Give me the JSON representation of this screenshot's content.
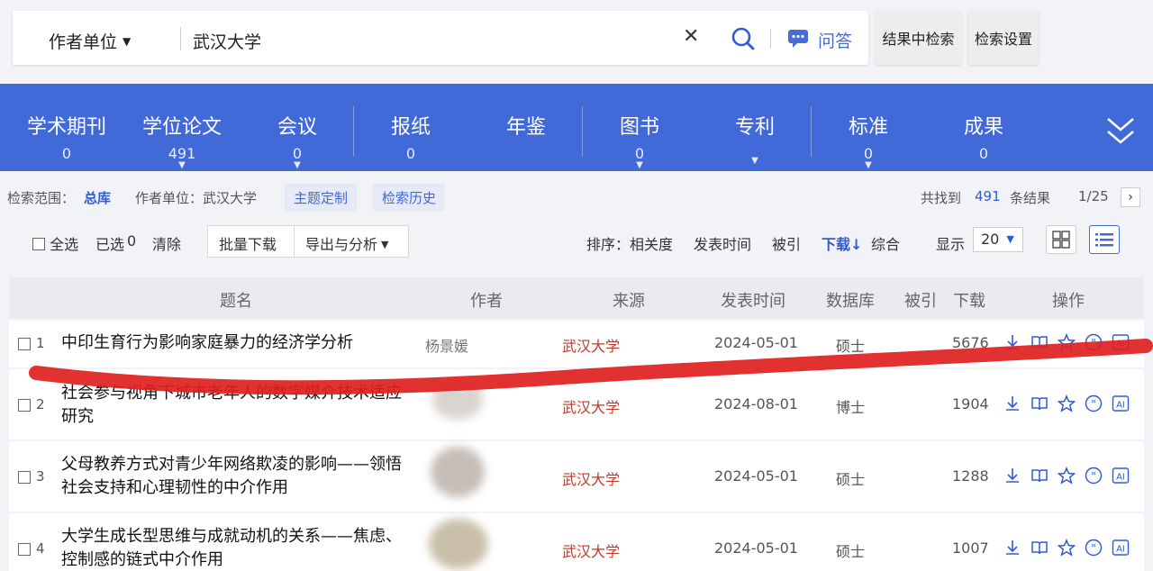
{
  "search": {
    "field": "作者单位",
    "query": "武汉大学",
    "qa_label": "问答",
    "within_results": "结果中检索",
    "settings": "检索设置"
  },
  "tabs": [
    {
      "label": "学术期刊",
      "count": "0"
    },
    {
      "label": "学位论文",
      "count": "491"
    },
    {
      "label": "会议",
      "count": "0"
    },
    {
      "label": "报纸",
      "count": "0"
    },
    {
      "label": "年鉴",
      "count": ""
    },
    {
      "label": "图书",
      "count": "0"
    },
    {
      "label": "专利",
      "count": ""
    },
    {
      "label": "标准",
      "count": "0"
    },
    {
      "label": "成果",
      "count": "0"
    }
  ],
  "scope": {
    "label": "检索范围：",
    "value": "总库",
    "filter": "作者单位：武汉大学",
    "topic_btn": "主题定制",
    "history_btn": "检索历史",
    "found_label": "共找到",
    "found_count": "491",
    "found_suffix": "条结果",
    "page": "1/25"
  },
  "toolbar": {
    "select_all": "全选",
    "selected": "已选",
    "selected_count": "0",
    "clear": "清除",
    "batch_download": "批量下载",
    "export": "导出与分析",
    "sort_label": "排序：",
    "sort_relevance": "相关度",
    "sort_date": "发表时间",
    "sort_cited": "被引",
    "sort_download": "下载",
    "sort_combined": "综合",
    "display_label": "显示",
    "page_size": "20"
  },
  "table": {
    "headers": {
      "title": "题名",
      "author": "作者",
      "source": "来源",
      "date": "发表时间",
      "db": "数据库",
      "cited": "被引",
      "downloads": "下载",
      "ops": "操作"
    },
    "rows": [
      {
        "num": "1",
        "title": "中印生育行为影响家庭暴力的经济学分析",
        "author": "杨景媛",
        "source": "武汉大学",
        "date": "2024-05-01",
        "db": "硕士",
        "downloads": "5676"
      },
      {
        "num": "2",
        "title": "社会参与视角下城市老年人的数字媒介技术适应研究",
        "author": "",
        "source": "武汉大学",
        "date": "2024-08-01",
        "db": "博士",
        "downloads": "1904"
      },
      {
        "num": "3",
        "title": "父母教养方式对青少年网络欺凌的影响——领悟社会支持和心理韧性的中介作用",
        "author": "",
        "source": "武汉大学",
        "date": "2024-05-01",
        "db": "硕士",
        "downloads": "1288"
      },
      {
        "num": "4",
        "title": "大学生成长型思维与成就动机的关系——焦虑、控制感的链式中介作用",
        "author": "",
        "source": "武汉大学",
        "date": "2024-05-01",
        "db": "硕士",
        "downloads": "1007"
      }
    ]
  },
  "colors": {
    "tab_bar": "#4169d8",
    "source_red": "#c0392b",
    "marker_red": "#e02020"
  }
}
